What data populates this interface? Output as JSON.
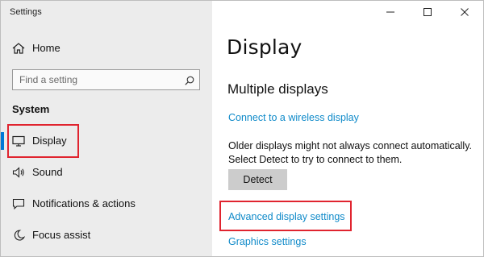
{
  "window": {
    "title": "Settings"
  },
  "sidebar": {
    "home_label": "Home",
    "search_placeholder": "Find a setting",
    "section_label": "System",
    "items": [
      {
        "label": "Display",
        "icon": "monitor-icon",
        "selected": true
      },
      {
        "label": "Sound",
        "icon": "speaker-icon"
      },
      {
        "label": "Notifications & actions",
        "icon": "notification-icon"
      },
      {
        "label": "Focus assist",
        "icon": "moon-icon"
      }
    ]
  },
  "main": {
    "title": "Display",
    "subtitle": "Multiple displays",
    "wireless_link": "Connect to a wireless display",
    "detect_text_line1": "Older displays might not always connect automatically.",
    "detect_text_line2": "Select Detect to try to connect to them.",
    "detect_button": "Detect",
    "advanced_link": "Advanced display settings",
    "graphics_link": "Graphics settings"
  },
  "colors": {
    "accent": "#0078d7",
    "link": "#0f8ac9",
    "highlight_box": "#e0242f",
    "sidebar_bg": "#ececec"
  }
}
